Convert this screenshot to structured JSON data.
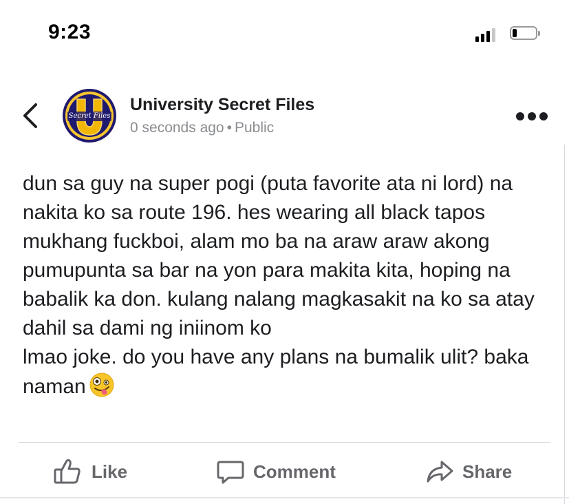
{
  "status_bar": {
    "time": "9:23",
    "signal_bars": 3,
    "signal_bars_total": 4,
    "battery_level": 0.2
  },
  "post": {
    "page_name": "University Secret Files",
    "timestamp": "0 seconds ago",
    "separator": "•",
    "audience": "Public",
    "avatar": {
      "icon": "university-secret-files-logo",
      "logo_letter": "U",
      "logo_text": "Secret Files",
      "colors": {
        "ring": "#1f1a6e",
        "fill": "#f2b705",
        "letter": "#f2b705"
      }
    },
    "body": "dun sa guy na super pogi (puta favorite ata ni lord) na nakita ko sa route 196. hes wearing all black tapos mukhang fuckboi, alam mo ba na araw araw akong pumupunta sa bar na yon para makita kita, hoping na babalik ka don. kulang nalang magkasakit na ko sa atay dahil sa dami ng iniinom ko\nlmao joke. do you have any plans na bumalik ulit? baka naman",
    "emoji": "zany-face-emoji"
  },
  "actions": {
    "like_label": "Like",
    "comment_label": "Comment",
    "share_label": "Share",
    "like_icon": "thumbs-up-icon",
    "comment_icon": "speech-bubble-icon",
    "share_icon": "share-arrow-icon"
  },
  "icons": {
    "back": "chevron-left-icon",
    "more": "more-options-icon"
  },
  "colors": {
    "text": "#1c1e21",
    "meta": "#8a8d91",
    "action": "#65676b",
    "divider": "#d8dadf"
  }
}
